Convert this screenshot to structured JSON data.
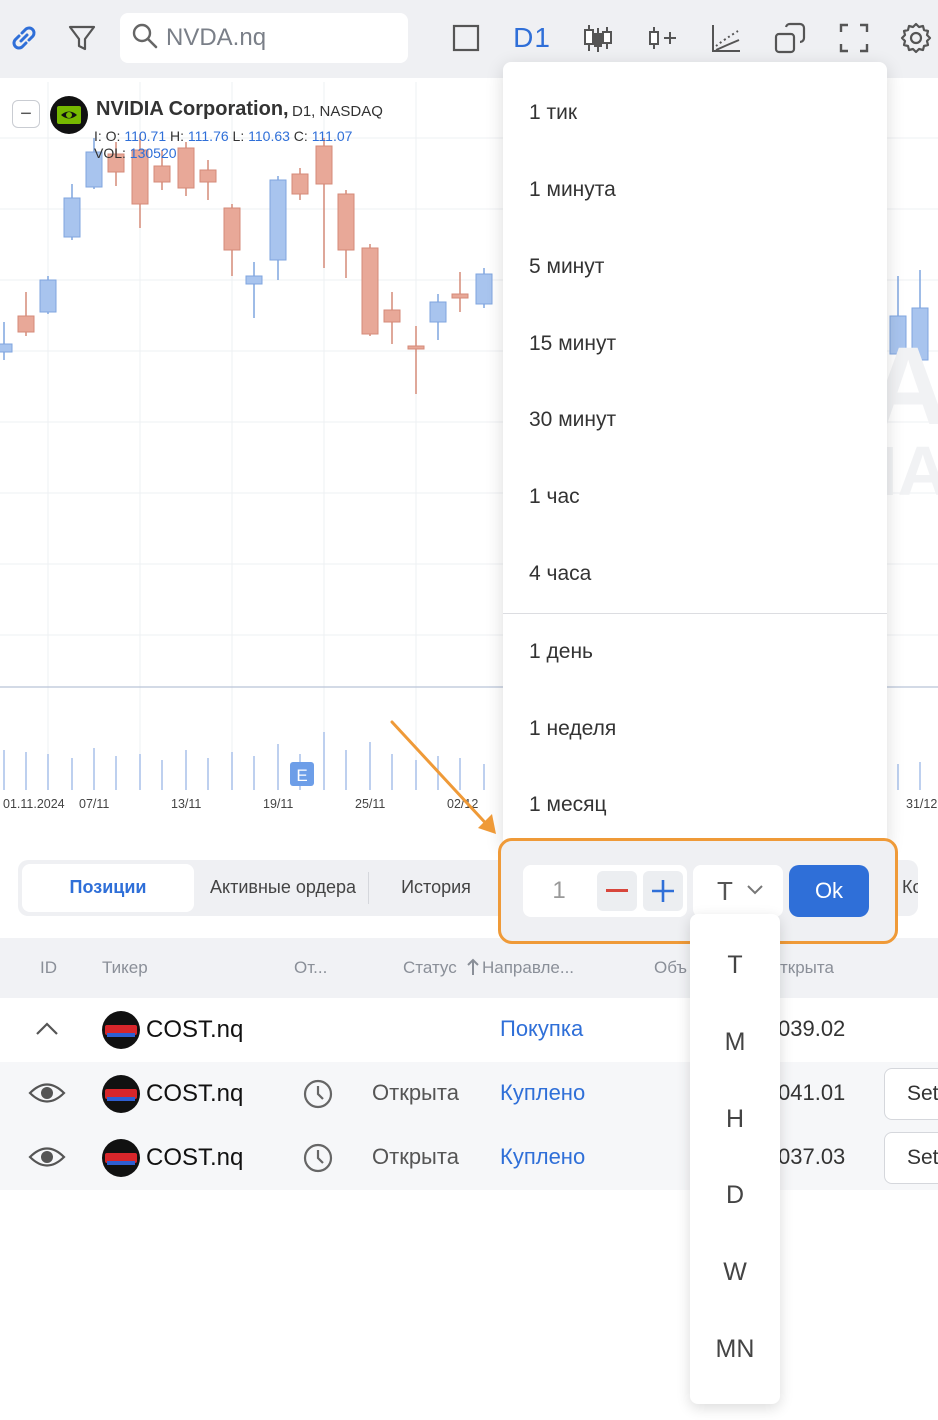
{
  "toolbar": {
    "search_placeholder": "NVDA.nq",
    "timeframe_label": "D1"
  },
  "chart": {
    "company": "NVIDIA Corporation,",
    "timeframe": "D1,",
    "exchange": "NASDAQ",
    "ohlc": {
      "o_label": "I: O:",
      "o": "110.71",
      "h_label": "H:",
      "h": "111.76",
      "l_label": "L:",
      "l": "110.63",
      "c_label": "C:",
      "c": "111.07"
    },
    "volume": {
      "label": "VOL:",
      "value": "130520"
    },
    "event_marker": "E",
    "watermark_line1": "DA",
    "watermark_line2": "DIA",
    "x_tick_labels": [
      "01.11.2024",
      "07/11",
      "13/11",
      "19/11",
      "25/11",
      "02/12",
      "31/12"
    ]
  },
  "timeframe_menu": {
    "items": [
      "1 тик",
      "1 минута",
      "5 минут",
      "15 минут",
      "30 минут",
      "1 час",
      "4 часа",
      "1 день",
      "1 неделя",
      "1 месяц"
    ]
  },
  "custom_timeframe": {
    "value": "1",
    "unit": "T",
    "ok_label": "Ok",
    "unit_options": [
      "T",
      "M",
      "H",
      "D",
      "W",
      "MN"
    ]
  },
  "tabs": {
    "positions": "Позиции",
    "active_orders": "Активные ордера",
    "history": "История",
    "more": "Кор"
  },
  "table": {
    "headers": {
      "id": "ID",
      "ticker": "Тикер",
      "open": "От...",
      "status": "Статус",
      "direction": "Направле...",
      "volume": "Объ",
      "opened": "ткрыта"
    },
    "rows": [
      {
        "ticker": "COST.nq",
        "status": "",
        "direction": "Покупка",
        "price": "039.02"
      },
      {
        "ticker": "COST.nq",
        "status": "Открыта",
        "direction": "Куплено",
        "price": "041.01",
        "action": "Set"
      },
      {
        "ticker": "COST.nq",
        "status": "Открыта",
        "direction": "Куплено",
        "price": "037.03",
        "action": "Set"
      }
    ]
  },
  "colors": {
    "accent": "#2f6fd8",
    "bull_candle": "#a8c4ee",
    "bear_candle": "#e8a898",
    "highlight": "#ef9a38"
  }
}
